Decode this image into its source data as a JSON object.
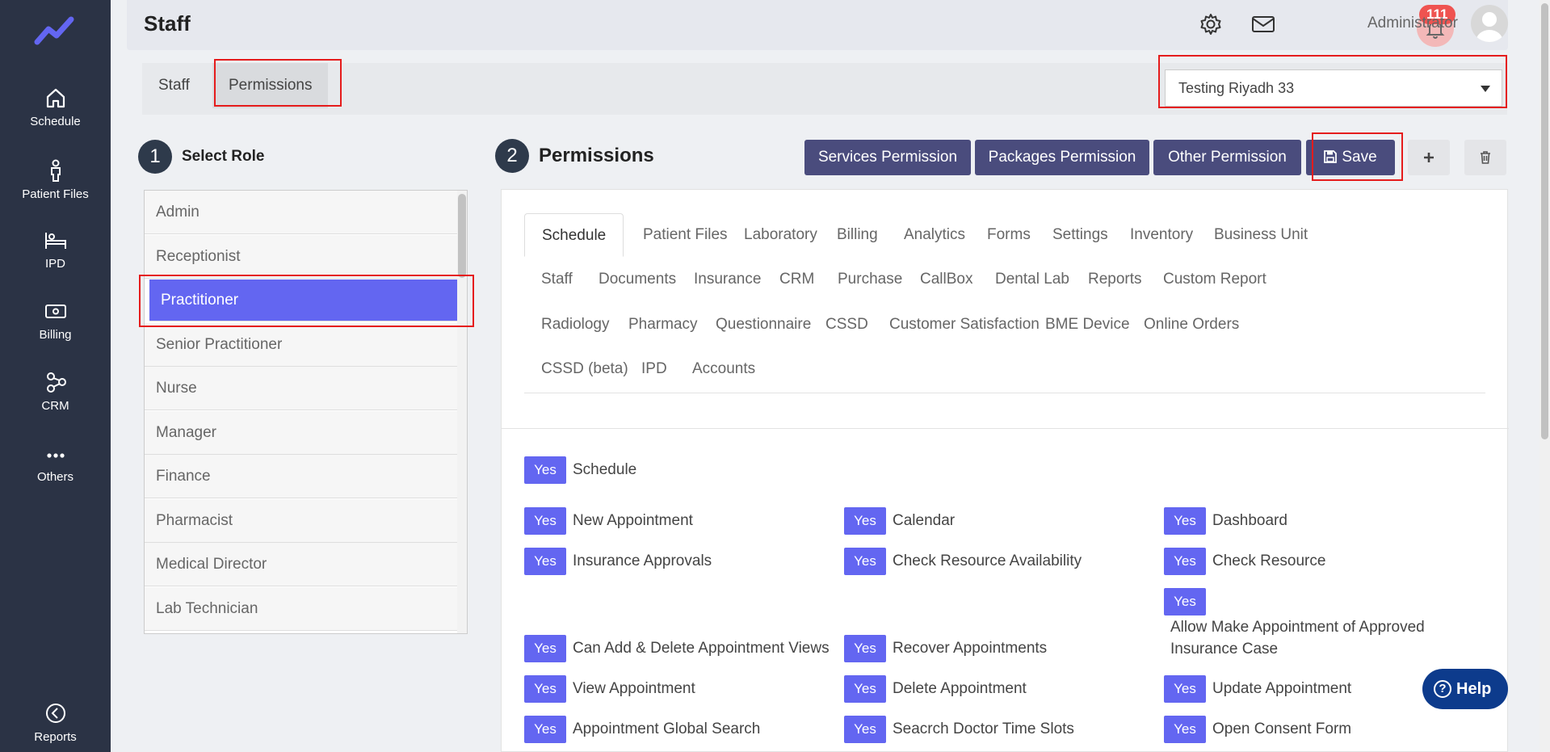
{
  "sidebar": {
    "logo": "chart-logo-icon",
    "items": [
      {
        "label": "Schedule",
        "icon": "home-icon"
      },
      {
        "label": "Patient Files",
        "icon": "person-icon"
      },
      {
        "label": "IPD",
        "icon": "bed-icon"
      },
      {
        "label": "Billing",
        "icon": "money-icon"
      },
      {
        "label": "CRM",
        "icon": "network-icon"
      },
      {
        "label": "Others",
        "icon": "ellipsis-icon"
      },
      {
        "label": "Reports",
        "icon": "pie-icon"
      }
    ]
  },
  "header": {
    "title": "Staff",
    "notification_count": "111",
    "user_name": "Administrator"
  },
  "top_tabs": [
    {
      "label": "Staff"
    },
    {
      "label": "Permissions"
    }
  ],
  "branch": {
    "selected": "Testing Riyadh 33"
  },
  "steps": {
    "one_num": "1",
    "one_label": "Select Role",
    "two_num": "2",
    "two_label": "Permissions"
  },
  "roles": [
    "Admin",
    "Receptionist",
    "Practitioner",
    "Senior Practitioner",
    "Nurse",
    "Manager",
    "Finance",
    "Pharmacist",
    "Medical Director",
    "Lab Technician"
  ],
  "buttons": {
    "services": "Services Permission",
    "packages": "Packages Permission",
    "other": "Other Permission",
    "save": "Save"
  },
  "module_tabs": [
    "Schedule",
    "Patient Files",
    "Laboratory",
    "Billing",
    "Analytics",
    "Forms",
    "Settings",
    "Inventory",
    "Business Unit",
    "Staff",
    "Documents",
    "Insurance",
    "CRM",
    "Purchase",
    "CallBox",
    "Dental Lab",
    "Reports",
    "Custom Report",
    "Radiology",
    "Pharmacy",
    "Questionnaire",
    "CSSD",
    "Customer Satisfaction",
    "BME Device",
    "Online Orders",
    "CSSD (beta)",
    "IPD",
    "Accounts"
  ],
  "yes_label": "Yes",
  "permissions": {
    "main": "Schedule",
    "items": [
      "New Appointment",
      "Calendar",
      "Dashboard",
      "Insurance Approvals",
      "Check Resource Availability",
      "Check Resource",
      "Allow Make Appointment of Approved Insurance Case",
      "Can Add & Delete Appointment Views",
      "Recover Appointments",
      "View Appointment",
      "Delete Appointment",
      "Update Appointment",
      "Appointment Global Search",
      "Seacrch Doctor Time Slots",
      "Open Consent Form"
    ]
  },
  "help": {
    "label": "Help"
  },
  "colors": {
    "sidebar": "#2b3345",
    "accent": "#6366f1",
    "button": "#4a4c7d",
    "highlight": "#e51c1c"
  }
}
